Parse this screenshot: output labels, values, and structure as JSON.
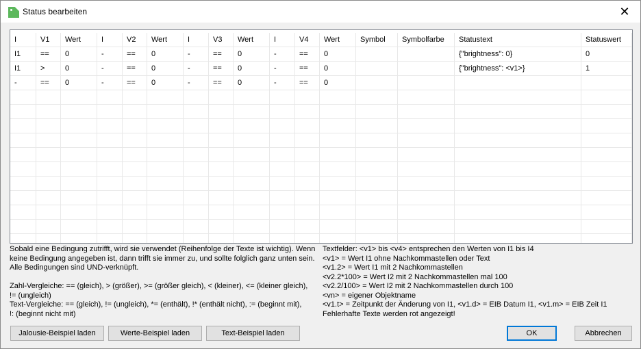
{
  "window": {
    "title": "Status bearbeiten",
    "close_icon": "close-icon"
  },
  "table": {
    "columns": [
      "I",
      "V1",
      "Wert",
      "I",
      "V2",
      "Wert",
      "I",
      "V3",
      "Wert",
      "I",
      "V4",
      "Wert",
      "Symbol",
      "Symbolfarbe",
      "Statustext",
      "Statuswert"
    ],
    "rows": [
      [
        "I1",
        "==",
        "0",
        "-",
        "==",
        "0",
        "-",
        "==",
        "0",
        "-",
        "==",
        "0",
        "",
        "",
        "{\"brightness\": 0}",
        "0"
      ],
      [
        "I1",
        ">",
        "0",
        "-",
        "==",
        "0",
        "-",
        "==",
        "0",
        "-",
        "==",
        "0",
        "",
        "",
        "{\"brightness\": <v1>}",
        "1"
      ],
      [
        "-",
        "==",
        "0",
        "-",
        "==",
        "0",
        "-",
        "==",
        "0",
        "-",
        "==",
        "0",
        "",
        "",
        "",
        ""
      ]
    ]
  },
  "help_left": [
    "Sobald eine Bedingung zutrifft, wird sie verwendet (Reihenfolge der Texte ist wichtig). Wenn",
    "keine Bedingung angegeben ist, dann trifft sie immer zu, und sollte folglich ganz unten sein.",
    "Alle Bedingungen sind UND-verknüpft.",
    "",
    "Zahl-Vergleiche: == (gleich), > (größer), >= (größer gleich), < (kleiner), <= (kleiner gleich),",
    "!= (ungleich)",
    "Text-Vergleiche: == (gleich), != (ungleich), *= (enthält), !* (enthält nicht), := (beginnt mit),",
    "!: (beginnt nicht mit)"
  ],
  "help_right": [
    "Textfelder: <v1> bis <v4> entsprechen den Werten von I1 bis I4",
    "<v1> = Wert I1 ohne Nachkommastellen oder Text",
    "<v1.2> = Wert I1 mit 2 Nachkommastellen",
    "<v2.2*100> = Wert I2 mit 2 Nachkommastellen mal 100",
    "<v2.2/100> = Wert I2 mit 2 Nachkommastellen durch 100",
    "<vn> = eigener Objektname",
    "<v1.t> = Zeitpunkt der Änderung von I1, <v1.d> = EIB Datum I1, <v1.m> = EIB Zeit I1",
    "Fehlerhafte Texte werden rot angezeigt!"
  ],
  "buttons": {
    "jalousie": "Jalousie-Beispiel laden",
    "werte": "Werte-Beispiel laden",
    "text": "Text-Beispiel laden",
    "ok": "OK",
    "cancel": "Abbrechen"
  }
}
